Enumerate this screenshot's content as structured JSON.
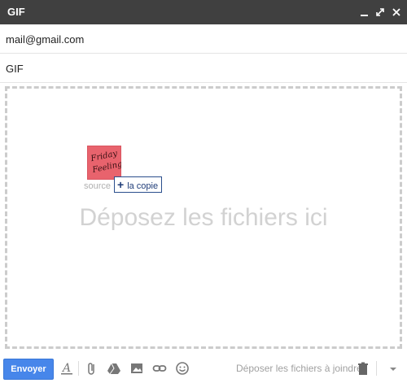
{
  "window": {
    "title": "GIF"
  },
  "fields": {
    "to_value": "mail@gmail.com",
    "subject_value": "GIF"
  },
  "dropzone": {
    "message": "Déposez les fichiers ici",
    "dragged_file": {
      "label": "source",
      "thumbnail_text": "Friday Feeling"
    },
    "copy_tooltip": "la copie"
  },
  "toolbar": {
    "send_label": "Envoyer",
    "attach_hint": "Déposer les fichiers à joindre",
    "icons": [
      "format-text-icon",
      "paperclip-icon",
      "drive-icon",
      "image-icon",
      "link-icon",
      "emoji-icon",
      "trash-icon",
      "more-options-icon"
    ]
  },
  "colors": {
    "titlebar": "#404040",
    "send_button": "#4786ea",
    "tooltip_border": "#2a4e8c",
    "thumbnail": "#e8636d"
  }
}
